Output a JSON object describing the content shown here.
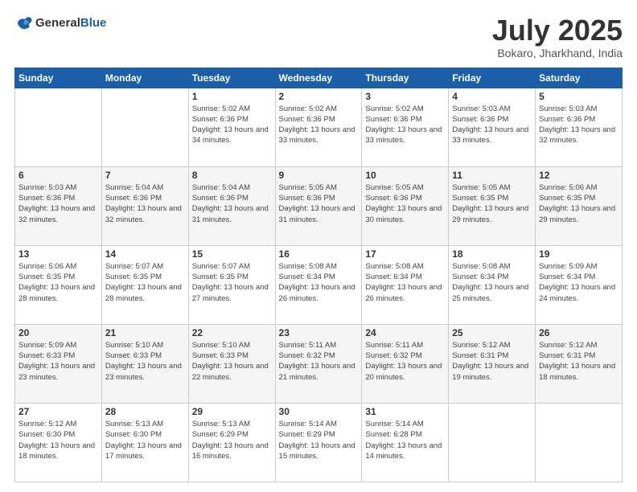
{
  "header": {
    "logo": {
      "general": "General",
      "blue": "Blue"
    },
    "title": "July 2025",
    "location": "Bokaro, Jharkhand, India"
  },
  "calendar": {
    "days_of_week": [
      "Sunday",
      "Monday",
      "Tuesday",
      "Wednesday",
      "Thursday",
      "Friday",
      "Saturday"
    ],
    "weeks": [
      [
        {
          "day": null
        },
        {
          "day": null
        },
        {
          "day": "1",
          "sunrise": "Sunrise: 5:02 AM",
          "sunset": "Sunset: 6:36 PM",
          "daylight": "Daylight: 13 hours and 34 minutes."
        },
        {
          "day": "2",
          "sunrise": "Sunrise: 5:02 AM",
          "sunset": "Sunset: 6:36 PM",
          "daylight": "Daylight: 13 hours and 33 minutes."
        },
        {
          "day": "3",
          "sunrise": "Sunrise: 5:02 AM",
          "sunset": "Sunset: 6:36 PM",
          "daylight": "Daylight: 13 hours and 33 minutes."
        },
        {
          "day": "4",
          "sunrise": "Sunrise: 5:03 AM",
          "sunset": "Sunset: 6:36 PM",
          "daylight": "Daylight: 13 hours and 33 minutes."
        },
        {
          "day": "5",
          "sunrise": "Sunrise: 5:03 AM",
          "sunset": "Sunset: 6:36 PM",
          "daylight": "Daylight: 13 hours and 32 minutes."
        }
      ],
      [
        {
          "day": "6",
          "sunrise": "Sunrise: 5:03 AM",
          "sunset": "Sunset: 6:36 PM",
          "daylight": "Daylight: 13 hours and 32 minutes."
        },
        {
          "day": "7",
          "sunrise": "Sunrise: 5:04 AM",
          "sunset": "Sunset: 6:36 PM",
          "daylight": "Daylight: 13 hours and 32 minutes."
        },
        {
          "day": "8",
          "sunrise": "Sunrise: 5:04 AM",
          "sunset": "Sunset: 6:36 PM",
          "daylight": "Daylight: 13 hours and 31 minutes."
        },
        {
          "day": "9",
          "sunrise": "Sunrise: 5:05 AM",
          "sunset": "Sunset: 6:36 PM",
          "daylight": "Daylight: 13 hours and 31 minutes."
        },
        {
          "day": "10",
          "sunrise": "Sunrise: 5:05 AM",
          "sunset": "Sunset: 6:36 PM",
          "daylight": "Daylight: 13 hours and 30 minutes."
        },
        {
          "day": "11",
          "sunrise": "Sunrise: 5:05 AM",
          "sunset": "Sunset: 6:35 PM",
          "daylight": "Daylight: 13 hours and 29 minutes."
        },
        {
          "day": "12",
          "sunrise": "Sunrise: 5:06 AM",
          "sunset": "Sunset: 6:35 PM",
          "daylight": "Daylight: 13 hours and 29 minutes."
        }
      ],
      [
        {
          "day": "13",
          "sunrise": "Sunrise: 5:06 AM",
          "sunset": "Sunset: 6:35 PM",
          "daylight": "Daylight: 13 hours and 28 minutes."
        },
        {
          "day": "14",
          "sunrise": "Sunrise: 5:07 AM",
          "sunset": "Sunset: 6:35 PM",
          "daylight": "Daylight: 13 hours and 28 minutes."
        },
        {
          "day": "15",
          "sunrise": "Sunrise: 5:07 AM",
          "sunset": "Sunset: 6:35 PM",
          "daylight": "Daylight: 13 hours and 27 minutes."
        },
        {
          "day": "16",
          "sunrise": "Sunrise: 5:08 AM",
          "sunset": "Sunset: 6:34 PM",
          "daylight": "Daylight: 13 hours and 26 minutes."
        },
        {
          "day": "17",
          "sunrise": "Sunrise: 5:08 AM",
          "sunset": "Sunset: 6:34 PM",
          "daylight": "Daylight: 13 hours and 26 minutes."
        },
        {
          "day": "18",
          "sunrise": "Sunrise: 5:08 AM",
          "sunset": "Sunset: 6:34 PM",
          "daylight": "Daylight: 13 hours and 25 minutes."
        },
        {
          "day": "19",
          "sunrise": "Sunrise: 5:09 AM",
          "sunset": "Sunset: 6:34 PM",
          "daylight": "Daylight: 13 hours and 24 minutes."
        }
      ],
      [
        {
          "day": "20",
          "sunrise": "Sunrise: 5:09 AM",
          "sunset": "Sunset: 6:33 PM",
          "daylight": "Daylight: 13 hours and 23 minutes."
        },
        {
          "day": "21",
          "sunrise": "Sunrise: 5:10 AM",
          "sunset": "Sunset: 6:33 PM",
          "daylight": "Daylight: 13 hours and 23 minutes."
        },
        {
          "day": "22",
          "sunrise": "Sunrise: 5:10 AM",
          "sunset": "Sunset: 6:33 PM",
          "daylight": "Daylight: 13 hours and 22 minutes."
        },
        {
          "day": "23",
          "sunrise": "Sunrise: 5:11 AM",
          "sunset": "Sunset: 6:32 PM",
          "daylight": "Daylight: 13 hours and 21 minutes."
        },
        {
          "day": "24",
          "sunrise": "Sunrise: 5:11 AM",
          "sunset": "Sunset: 6:32 PM",
          "daylight": "Daylight: 13 hours and 20 minutes."
        },
        {
          "day": "25",
          "sunrise": "Sunrise: 5:12 AM",
          "sunset": "Sunset: 6:31 PM",
          "daylight": "Daylight: 13 hours and 19 minutes."
        },
        {
          "day": "26",
          "sunrise": "Sunrise: 5:12 AM",
          "sunset": "Sunset: 6:31 PM",
          "daylight": "Daylight: 13 hours and 18 minutes."
        }
      ],
      [
        {
          "day": "27",
          "sunrise": "Sunrise: 5:12 AM",
          "sunset": "Sunset: 6:30 PM",
          "daylight": "Daylight: 13 hours and 18 minutes."
        },
        {
          "day": "28",
          "sunrise": "Sunrise: 5:13 AM",
          "sunset": "Sunset: 6:30 PM",
          "daylight": "Daylight: 13 hours and 17 minutes."
        },
        {
          "day": "29",
          "sunrise": "Sunrise: 5:13 AM",
          "sunset": "Sunset: 6:29 PM",
          "daylight": "Daylight: 13 hours and 16 minutes."
        },
        {
          "day": "30",
          "sunrise": "Sunrise: 5:14 AM",
          "sunset": "Sunset: 6:29 PM",
          "daylight": "Daylight: 13 hours and 15 minutes."
        },
        {
          "day": "31",
          "sunrise": "Sunrise: 5:14 AM",
          "sunset": "Sunset: 6:28 PM",
          "daylight": "Daylight: 13 hours and 14 minutes."
        },
        {
          "day": null
        },
        {
          "day": null
        }
      ]
    ]
  }
}
